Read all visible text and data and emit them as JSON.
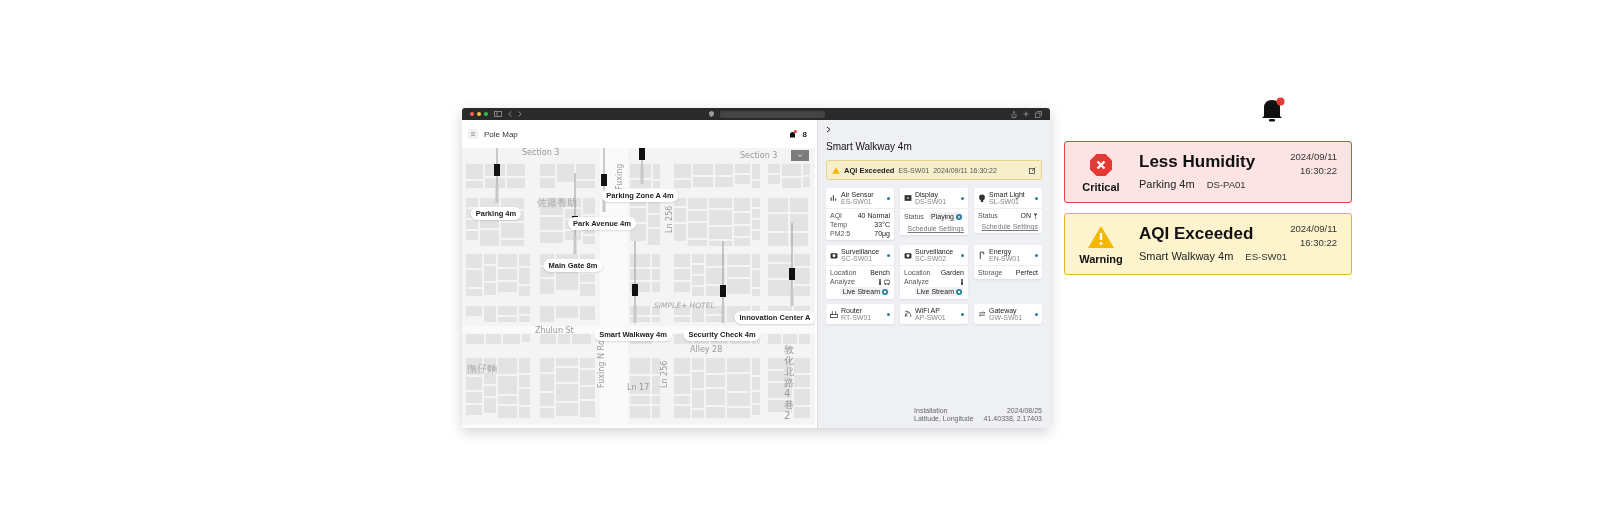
{
  "bell": {
    "unread": true
  },
  "browser": {
    "app_title": "Pole Map",
    "notification_count": "8"
  },
  "map": {
    "street_labels": [
      {
        "kind": "horizontal",
        "text": "Section 3"
      },
      {
        "kind": "horizontal",
        "text": "Section 3"
      },
      {
        "kind": "vertical",
        "text": "Fuxing"
      },
      {
        "kind": "vertical",
        "text": "Ln 256"
      },
      {
        "kind": "cjk",
        "text": "佐藤養助"
      },
      {
        "kind": "place",
        "text": "SIMPLE+ HOTEL"
      },
      {
        "kind": "horizontal",
        "text": "Zhulun St"
      },
      {
        "kind": "horizontal",
        "text": "Alley 28"
      },
      {
        "kind": "vertical",
        "text": "Fuxing N Rd"
      },
      {
        "kind": "vertical",
        "text": "Ln 256"
      },
      {
        "kind": "horizontal",
        "text": "Ln 17"
      },
      {
        "kind": "cjk",
        "text": "撫仔麵"
      },
      {
        "kind": "cjk_vertical",
        "text": "敦化北路4巷2"
      }
    ],
    "pole_labels": [
      "Parking 4m",
      "Parking Zone A 4m",
      "Park Avenue 4m",
      "Main Gate 8m",
      "Smart Walkway 4m",
      "Security Check 4m",
      "Innovation Center A"
    ]
  },
  "panel": {
    "title": "Smart Walkway 4m",
    "alert": {
      "kind": "warning",
      "title": "AQI Exceeded",
      "device": "ES-SW01",
      "time": "2024/09/11 16:30:22"
    },
    "devices": [
      {
        "kind": "sensor",
        "name": "Air Sensor",
        "id": "ES-SW01",
        "online": true,
        "rows": [
          {
            "kind": "value",
            "label": "AQI",
            "value": "40 Normal"
          },
          {
            "kind": "value",
            "label": "Temp",
            "value": "33°C"
          },
          {
            "kind": "value",
            "label": "PM2.5",
            "value": "70μg"
          }
        ]
      },
      {
        "kind": "display",
        "name": "Display",
        "id": "DS-SW01",
        "online": true,
        "rows": [
          {
            "kind": "player",
            "label": "Status",
            "value": "Playing",
            "playing": true
          }
        ],
        "action": {
          "kind": "link",
          "label": "Schedule Settings"
        }
      },
      {
        "kind": "light",
        "name": "Smart Light",
        "id": "SL-SW01",
        "online": true,
        "rows": [
          {
            "kind": "switch",
            "label": "Status",
            "value": "ON",
            "on": true
          }
        ],
        "action": {
          "kind": "link",
          "label": "Schedule Settings"
        }
      },
      {
        "kind": "camera",
        "name": "Surveillance",
        "id": "SC-SW01",
        "online": true,
        "rows": [
          {
            "kind": "value",
            "label": "Location",
            "value": "Bench"
          },
          {
            "kind": "analyze",
            "label": "Analyze",
            "vehicle": true
          }
        ],
        "action": {
          "kind": "stream",
          "label": "Live Stream"
        }
      },
      {
        "kind": "camera",
        "name": "Surveillance",
        "id": "SC-SW02",
        "online": true,
        "rows": [
          {
            "kind": "value",
            "label": "Location",
            "value": "Garden"
          },
          {
            "kind": "analyze",
            "label": "Analyze",
            "vehicle": false
          }
        ],
        "action": {
          "kind": "stream",
          "label": "Live Stream"
        }
      },
      {
        "kind": "energy",
        "name": "Energy",
        "id": "EN-SW01",
        "online": true,
        "rows": [
          {
            "kind": "value",
            "label": "Storage",
            "value": "Perfect"
          }
        ]
      },
      {
        "kind": "router",
        "name": "Router",
        "id": "RT-SW01",
        "online": true
      },
      {
        "kind": "wifi",
        "name": "WiFi AP",
        "id": "AP-SW01",
        "online": true
      },
      {
        "kind": "gateway",
        "name": "Gateway",
        "id": "GW-SW01",
        "online": true
      }
    ],
    "footer": [
      {
        "label": "Installation",
        "value": "2024/08/25"
      },
      {
        "label": "Latitude, Longitude",
        "value": "41.40338, 2.17403"
      }
    ]
  },
  "notifications": [
    {
      "kind": "critical",
      "badge": "Critical",
      "title": "Less Humidity",
      "location": "Parking 4m",
      "device": "DS-PA01",
      "date": "2024/09/11",
      "time": "16:30:22"
    },
    {
      "kind": "warning",
      "badge": "Warning",
      "title": "AQI Exceeded",
      "location": "Smart Walkway 4m",
      "device": "ES-SW01",
      "date": "2024/09/11",
      "time": "16:30:22"
    }
  ]
}
